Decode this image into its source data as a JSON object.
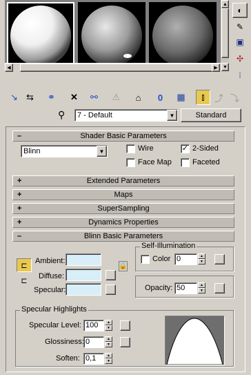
{
  "material": {
    "name": "7 - Default",
    "type_button": "Standard"
  },
  "rollouts": {
    "shader_basic": "Shader Basic Parameters",
    "extended": "Extended Parameters",
    "maps": "Maps",
    "supersampling": "SuperSampling",
    "dynamics": "Dynamics Properties",
    "blinn_basic": "Blinn Basic Parameters",
    "expanded_symbol": "–",
    "collapsed_symbol": "+"
  },
  "shader": {
    "selected": "Blinn",
    "wire": "Wire",
    "two_sided": "2-Sided",
    "face_map": "Face Map",
    "faceted": "Faceted",
    "wire_checked": false,
    "two_sided_checked": true,
    "face_map_checked": false,
    "faceted_checked": false
  },
  "blinn": {
    "ambient": "Ambient:",
    "diffuse": "Diffuse:",
    "specular": "Specular:",
    "self_illum_title": "Self-Illumination",
    "color_label": "Color",
    "color_value": "0",
    "opacity_label": "Opacity:",
    "opacity_value": "50",
    "swatch_color": "#d8eef8"
  },
  "highlights": {
    "title": "Specular Highlights",
    "level_label": "Specular Level:",
    "level_value": "100",
    "gloss_label": "Glossiness:",
    "gloss_value": "0",
    "soften_label": "Soften:",
    "soften_value": "0,1"
  },
  "colors": {
    "window_bg": "#d4d0c8",
    "active_tool": "#e8c850"
  }
}
